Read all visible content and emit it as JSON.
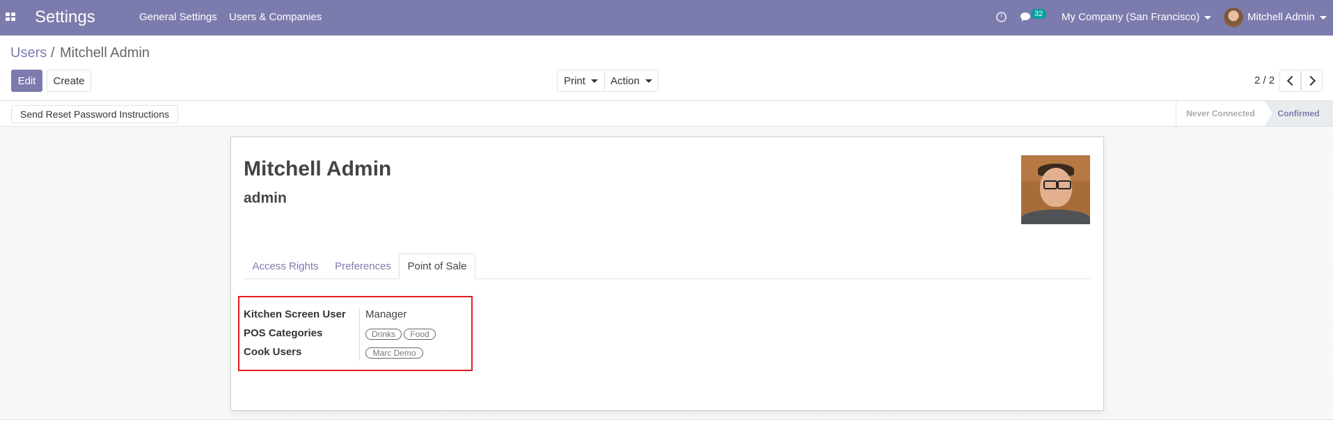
{
  "topbar": {
    "app_title": "Settings",
    "menu": [
      "General Settings",
      "Users & Companies"
    ],
    "message_count": "32",
    "company": "My Company (San Francisco)",
    "user": "Mitchell Admin"
  },
  "breadcrumb": {
    "parent": "Users",
    "separator": "/",
    "current": "Mitchell Admin"
  },
  "toolbar": {
    "edit_label": "Edit",
    "create_label": "Create",
    "print_label": "Print",
    "action_label": "Action",
    "pager": "2 / 2"
  },
  "statusbar": {
    "reset_password_label": "Send Reset Password Instructions",
    "stages": [
      "Never Connected",
      "Confirmed"
    ],
    "active_stage": "Confirmed"
  },
  "record": {
    "name": "Mitchell Admin",
    "login": "admin",
    "tabs": [
      "Access Rights",
      "Preferences",
      "Point of Sale"
    ],
    "active_tab": "Point of Sale",
    "fields": [
      {
        "label": "Kitchen Screen User",
        "value": "Manager"
      },
      {
        "label": "POS Categories",
        "tags": [
          "Drinks",
          "Food"
        ]
      },
      {
        "label": "Cook Users",
        "tags": [
          "Marc Demo"
        ]
      }
    ]
  },
  "colors": {
    "brand": "#7c7bad",
    "highlight_box": "#e31b23",
    "badge": "#00a09d"
  }
}
